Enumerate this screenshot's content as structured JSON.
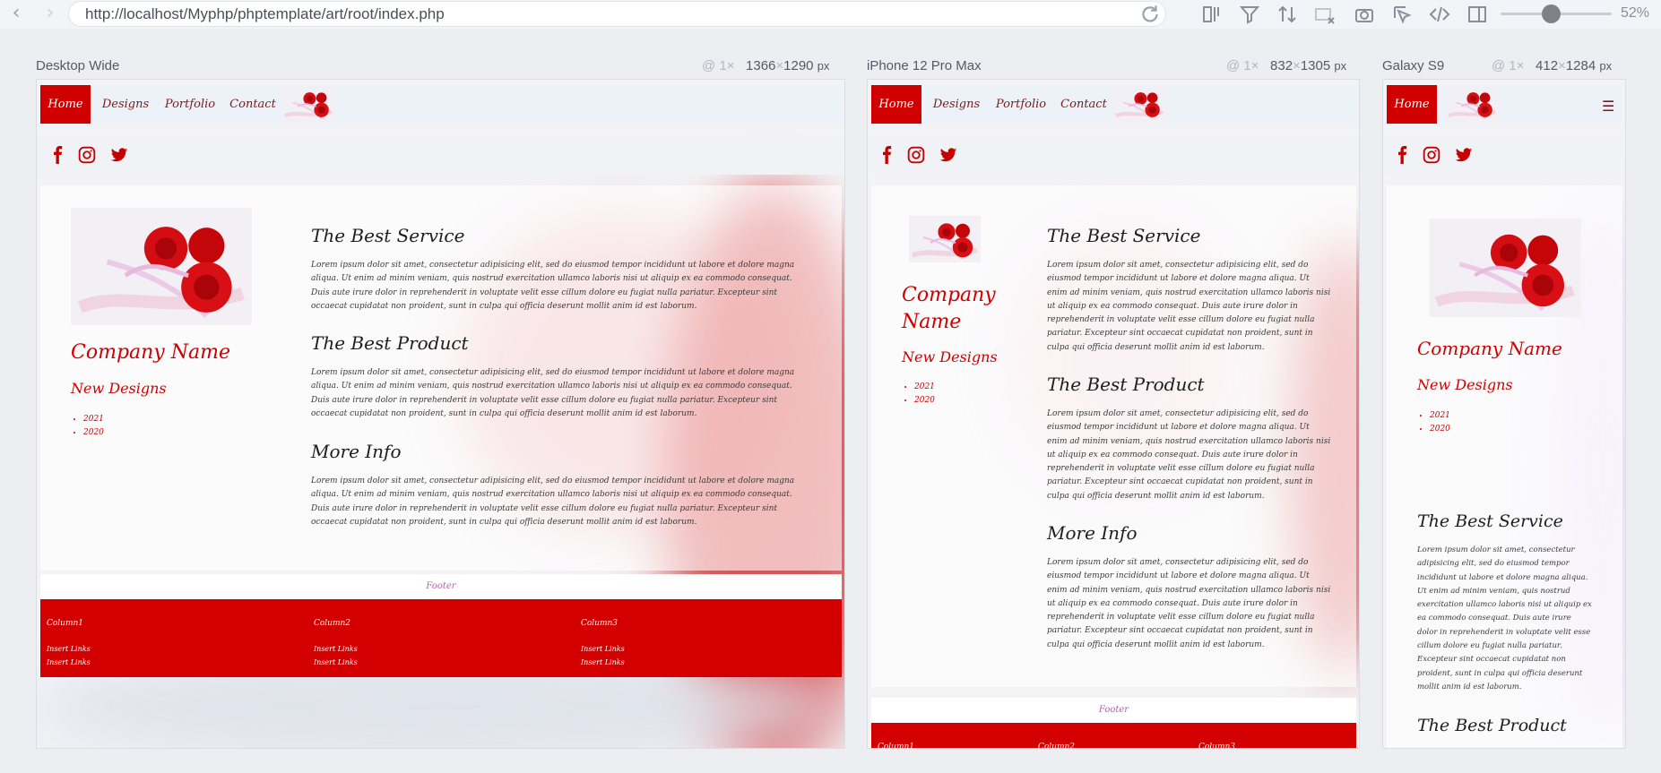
{
  "browser": {
    "url": "http://localhost/Myphp/phptemplate/art/root/index.php",
    "zoom": "52%"
  },
  "devices": [
    {
      "name": "Desktop Wide",
      "scale": "@ 1×",
      "width": "1366",
      "times": "×",
      "height": "1290",
      "unit": "px"
    },
    {
      "name": "iPhone 12 Pro Max",
      "scale": "@ 1×",
      "width": "832",
      "times": "×",
      "height": "1305",
      "unit": "px"
    },
    {
      "name": "Galaxy S9",
      "scale": "@ 1×",
      "width": "412",
      "times": "×",
      "height": "1284",
      "unit": "px"
    }
  ],
  "site": {
    "nav": [
      "Home",
      "Designs",
      "Portfolio",
      "Contact"
    ],
    "company": "Company Name",
    "new_designs": "New Designs",
    "years": [
      "2021",
      "2020"
    ],
    "sections": [
      {
        "title": "The Best Service"
      },
      {
        "title": "The Best Product"
      },
      {
        "title": "More Info"
      }
    ],
    "lorem": "Lorem ipsum dolor sit amet, consectetur adipisicing elit, sed do eiusmod tempor incididunt ut labore et dolore magna aliqua. Ut enim ad minim veniam, quis nostrud exercitation ullamco laboris nisi ut aliquip ex ea commodo consequat. Duis aute irure dolor in reprehenderit in voluptate velit esse cillum dolore eu fugiat nulla pariatur. Excepteur sint occaecat cupidatat non proident, sunt in culpa qui officia deserunt mollit anim id est laborum.",
    "footer": "Footer",
    "columns": [
      "Column1",
      "Column2",
      "Column3"
    ],
    "link": "Insert Links"
  },
  "colors": {
    "accent": "#d00000",
    "nav_text": "#7b1b1b"
  }
}
